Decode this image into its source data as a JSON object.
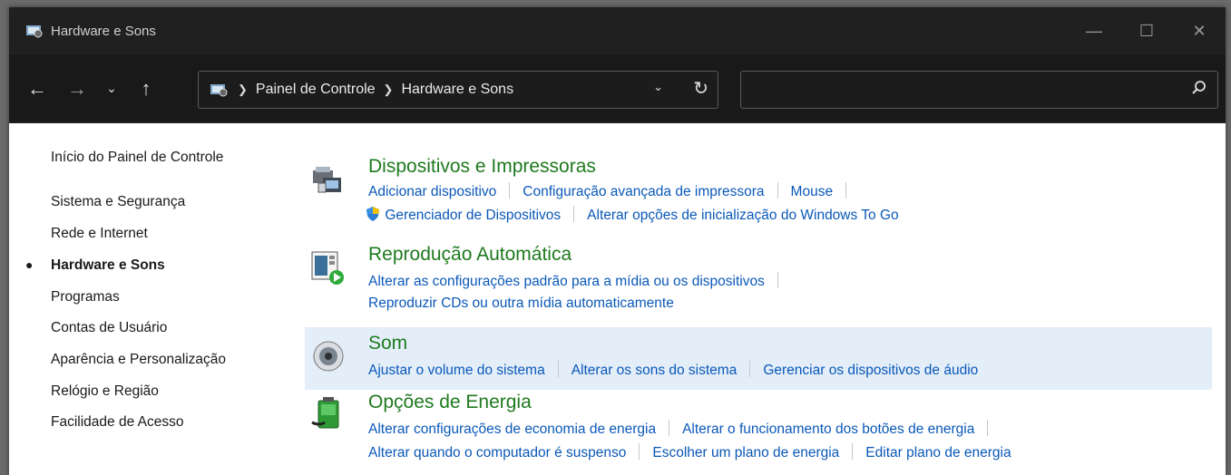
{
  "window": {
    "title": "Hardware e Sons"
  },
  "address": {
    "crumbs": [
      "Painel de Controle",
      "Hardware e Sons"
    ],
    "search_placeholder": ""
  },
  "sidebar": {
    "home": "Início do Painel de Controle",
    "items": [
      "Sistema e Segurança",
      "Rede e Internet",
      "Hardware e Sons",
      "Programas",
      "Contas de Usuário",
      "Aparência e Personalização",
      "Relógio e Região",
      "Facilidade de Acesso"
    ]
  },
  "categories": [
    {
      "title": "Dispositivos e Impressoras",
      "row1": [
        "Adicionar dispositivo",
        "Configuração avançada de impressora",
        "Mouse"
      ],
      "row2": [
        "Gerenciador de Dispositivos",
        "Alterar opções de inicialização do Windows To Go"
      ]
    },
    {
      "title": "Reprodução Automática",
      "row1": [
        "Alterar as configurações padrão para a mídia ou os dispositivos"
      ],
      "row2": [
        "Reproduzir CDs ou outra mídia automaticamente"
      ]
    },
    {
      "title": "Som",
      "row1": [
        "Ajustar o volume do sistema",
        "Alterar os sons do sistema",
        "Gerenciar os dispositivos de áudio"
      ]
    },
    {
      "title": "Opções de Energia",
      "row1": [
        "Alterar configurações de economia de energia",
        "Alterar o funcionamento dos botões de energia"
      ],
      "row2": [
        "Alterar quando o computador é suspenso",
        "Escolher um plano de energia",
        "Editar plano de energia"
      ]
    }
  ],
  "colors": {
    "title_green": "#1f7a1f",
    "link_blue": "#0a58b8",
    "highlight": "#e3eef9"
  },
  "icons": [
    "control-panel-icon",
    "devices-printers-icon",
    "autoplay-icon",
    "speaker-icon",
    "battery-plug-icon",
    "uac-shield-icon"
  ]
}
